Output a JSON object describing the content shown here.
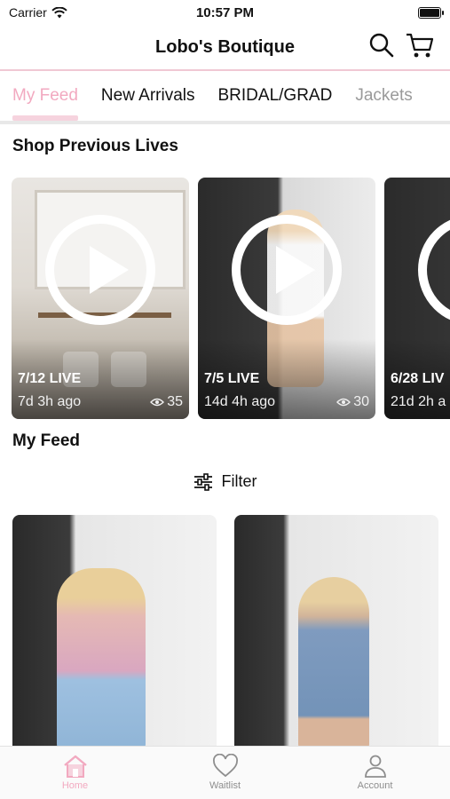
{
  "status_bar": {
    "carrier": "Carrier",
    "time": "10:57 PM"
  },
  "header": {
    "title": "Lobo's Boutique"
  },
  "tabs": [
    {
      "label": "My Feed",
      "state": "active"
    },
    {
      "label": "New Arrivals",
      "state": "normal"
    },
    {
      "label": "BRIDAL/GRAD",
      "state": "normal"
    },
    {
      "label": "Jackets",
      "state": "faded"
    }
  ],
  "previous_lives": {
    "title": "Shop Previous Lives",
    "cards": [
      {
        "label": "7/12 LIVE",
        "ago": "7d 3h ago",
        "views": "35"
      },
      {
        "label": "7/5 LIVE",
        "ago": "14d 4h ago",
        "views": "30"
      },
      {
        "label": "6/28 LIV",
        "ago": "21d 2h a"
      }
    ]
  },
  "feed": {
    "title": "My Feed",
    "filter_label": "Filter"
  },
  "bottom_nav": [
    {
      "label": "Home",
      "icon": "home-icon",
      "active": true
    },
    {
      "label": "Waitlist",
      "icon": "heart-icon",
      "active": false
    },
    {
      "label": "Account",
      "icon": "user-icon",
      "active": false
    }
  ],
  "colors": {
    "accent": "#f2a9c0",
    "accent_light": "#f6d3de",
    "divider": "#f0c8d4"
  }
}
